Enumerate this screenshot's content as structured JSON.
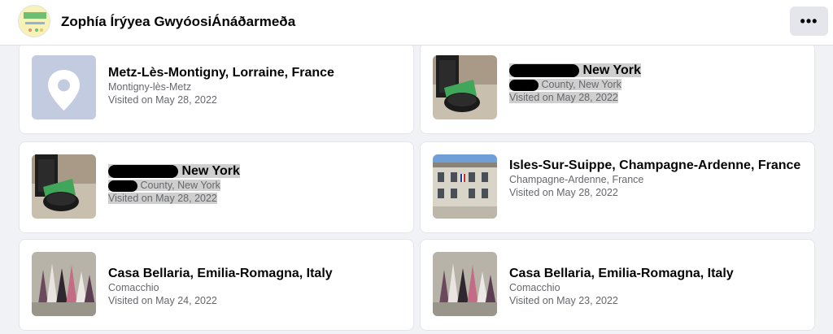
{
  "profile": {
    "name": "Zophía Írýyea GwyóosiÁnáðarmeða",
    "more_label": "•••"
  },
  "cards": [
    {
      "title": "Metz-Lès-Montigny, Lorraine, France",
      "subtitle": "Montigny-lès-Metz",
      "visited": "Visited on May 28, 2022",
      "thumb": "map-pin-icon"
    },
    {
      "title": "New York",
      "subtitle": "County, New York",
      "visited": "Visited on May 28, 2022",
      "thumb": "phone-photo"
    },
    {
      "title": "New York",
      "subtitle": "County, New York",
      "visited": "Visited on May 28, 2022",
      "thumb": "phone-photo"
    },
    {
      "title": "Isles-Sur-Suippe, Champagne-Ardenne, France",
      "subtitle": "Champagne-Ardenne, France",
      "visited": "Visited on May 28, 2022",
      "thumb": "building-photo"
    },
    {
      "title": "Casa Bellaria, Emilia-Romagna, Italy",
      "subtitle": "Comacchio",
      "visited": "Visited on May 24, 2022",
      "thumb": "ornaments-photo"
    },
    {
      "title": "Casa Bellaria, Emilia-Romagna, Italy",
      "subtitle": "Comacchio",
      "visited": "Visited on May 23, 2022",
      "thumb": "ornaments-photo"
    }
  ],
  "colors": {
    "background": "#f0f2f5",
    "card": "#ffffff",
    "secondary_text": "#65676b",
    "pin_bg": "#c3cbe0"
  }
}
